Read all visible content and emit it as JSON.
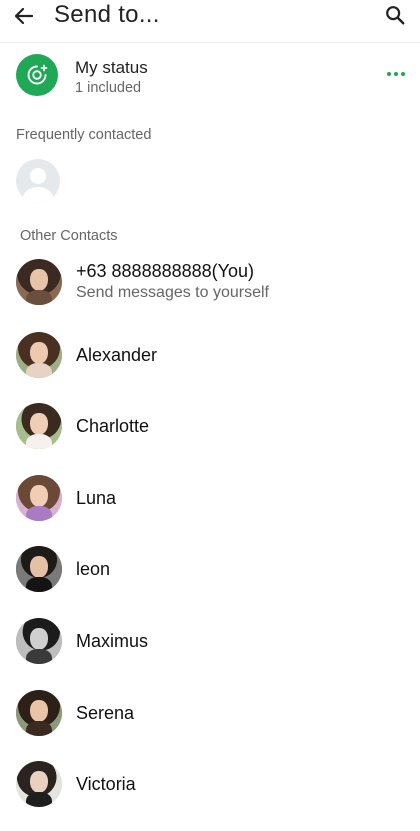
{
  "header": {
    "title": "Send to...",
    "back_icon": "arrow-left-icon",
    "search_icon": "search-icon"
  },
  "status": {
    "name": "My status",
    "subtitle": "1 included",
    "icon": "status-camera-icon",
    "accent": "#1fa855"
  },
  "sections": {
    "frequent": "Frequently contacted",
    "other": "Other Contacts"
  },
  "contacts": [
    {
      "name": "+63 8888888888(You)",
      "sub": "Send messages to yourself"
    },
    {
      "name": "Alexander"
    },
    {
      "name": "Charlotte"
    },
    {
      "name": "Luna"
    },
    {
      "name": "leon"
    },
    {
      "name": "Maximus"
    },
    {
      "name": "Serena"
    },
    {
      "name": "Victoria"
    }
  ]
}
